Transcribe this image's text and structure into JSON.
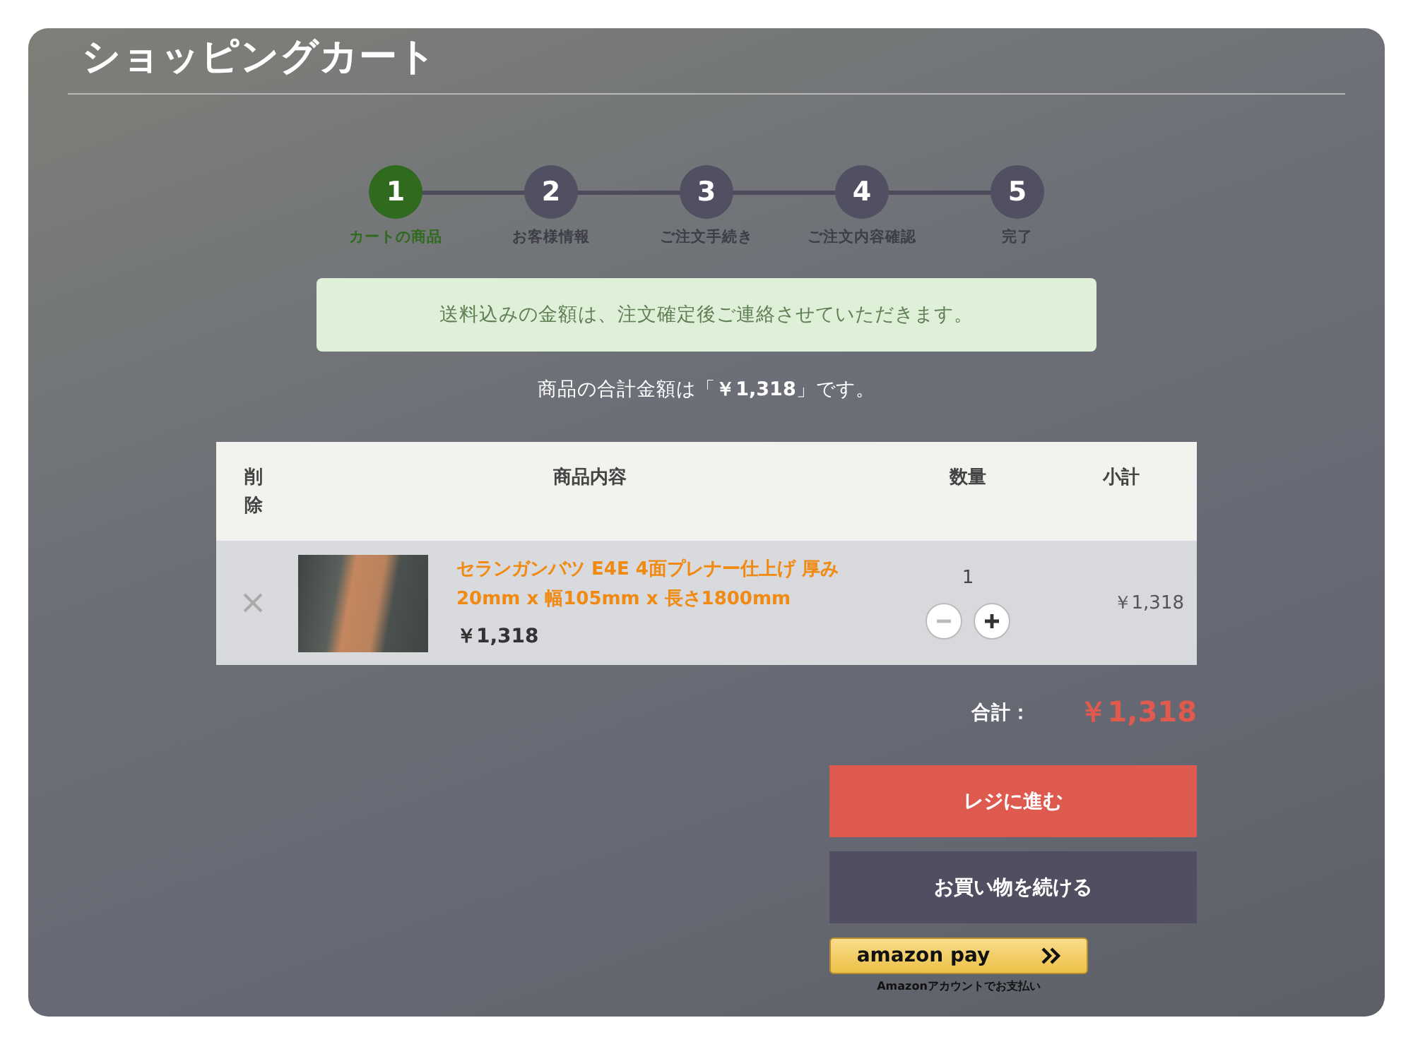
{
  "page_title": "ショッピングカート",
  "steps": [
    {
      "number": "1",
      "label": "カートの商品",
      "selected": true
    },
    {
      "number": "2",
      "label": "お客様情報",
      "selected": false
    },
    {
      "number": "3",
      "label": "ご注文手続き",
      "selected": false
    },
    {
      "number": "4",
      "label": "ご注文内容確認",
      "selected": false
    },
    {
      "number": "5",
      "label": "完了",
      "selected": false
    }
  ],
  "notice": "送料込みの金額は、注文確定後ご連絡させていただきます。",
  "total_summary": "商品の合計金額は「**￥1,318**」です。",
  "table": {
    "columns": [
      "削除",
      "商品内容",
      "数量",
      "小計"
    ],
    "rows": [
      {
        "name": "セランガンバツ E4E 4面プレナー仕上げ 厚み20mm x 幅105mm x 長さ1800mm",
        "price": "￥1,318",
        "quantity": "1",
        "subtotal": "￥1,318"
      }
    ]
  },
  "total": {
    "label": "合計：",
    "value": "￥1,318"
  },
  "buttons": [
    {
      "label": "レジに進む",
      "kind": "primary"
    },
    {
      "label": "お買い物を続ける",
      "kind": "secondary"
    }
  ],
  "amazon_pay": {
    "logo": "amazon pay",
    "caption": "Amazonアカウントでお支払い"
  }
}
